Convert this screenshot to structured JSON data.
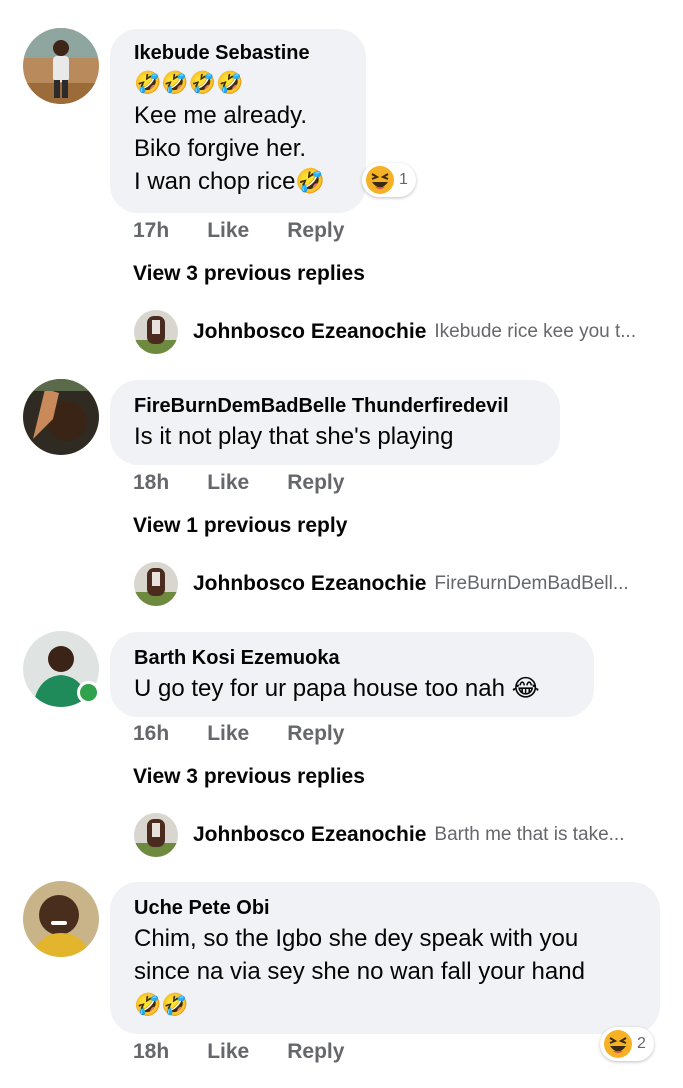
{
  "comments": [
    {
      "author": "Ikebude Sebastine",
      "emoji_row": "🤣🤣🤣🤣",
      "lines": [
        "Kee me already.",
        "Biko forgive her.",
        "I wan chop rice🤣"
      ],
      "time": "17h",
      "like": "Like",
      "reply": "Reply",
      "reaction_count": "1",
      "reaction_icon": "laughing-squint-emoji",
      "view_previous": "View 3 previous replies",
      "latest_reply": {
        "name": "Johnbosco Ezeanochie",
        "preview": "Ikebude rice kee you t..."
      }
    },
    {
      "author": "FireBurnDemBadBelle Thunderfiredevil",
      "lines": [
        "Is it not play that she's playing"
      ],
      "time": "18h",
      "like": "Like",
      "reply": "Reply",
      "view_previous": "View 1 previous reply",
      "latest_reply": {
        "name": "Johnbosco Ezeanochie",
        "preview": "FireBurnDemBadBell..."
      }
    },
    {
      "author": "Barth Kosi Ezemuoka",
      "lines": [
        "U go tey for ur papa house too nah 😂"
      ],
      "time": "16h",
      "like": "Like",
      "reply": "Reply",
      "online": true,
      "view_previous": "View 3 previous replies",
      "latest_reply": {
        "name": "Johnbosco Ezeanochie",
        "preview": "Barth me that is take..."
      }
    },
    {
      "author": "Uche Pete Obi",
      "lines": [
        "Chim, so the Igbo she dey speak with you",
        "since na via sey she no wan fall your hand",
        "🤣🤣"
      ],
      "time": "18h",
      "like": "Like",
      "reply": "Reply",
      "reaction_count": "2",
      "reaction_icon": "laughing-squint-emoji"
    }
  ],
  "colors": {
    "bubble": "#f0f2f5",
    "meta": "#65676b",
    "text": "#050505",
    "online": "#31a24c",
    "reaction_yellow": "#f7b125"
  }
}
